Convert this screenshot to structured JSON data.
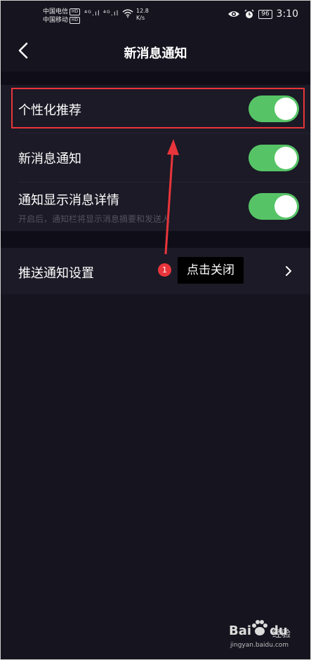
{
  "status_bar": {
    "carrier_1": "中国电信",
    "carrier_2": "中国移动",
    "hd_badge": "HD",
    "signal_1": "⁴ᴳ.ıl",
    "signal_2": "⁴ᴳ.ıl",
    "net_speed_value": "12.8",
    "net_speed_unit": "K/s",
    "battery": "96",
    "time": "3:10"
  },
  "header": {
    "title": "新消息通知"
  },
  "settings": {
    "personalized_recommendation": {
      "label": "个性化推荐",
      "enabled": true
    },
    "new_message_notification": {
      "label": "新消息通知",
      "enabled": true
    },
    "notification_details": {
      "label": "通知显示消息详情",
      "description": "开启后，通知栏将显示消息摘要和发送人",
      "enabled": true
    },
    "push_settings": {
      "label": "推送通知设置"
    }
  },
  "annotation": {
    "step_number": "1",
    "callout_text": "点击关闭",
    "color": "#e8353b"
  },
  "watermark": {
    "brand_left": "Bai",
    "brand_right": "du",
    "brand_cn": "经验",
    "url": "jingyan.baidu.com"
  },
  "colors": {
    "background": "#15141f",
    "panel": "#1b1a26",
    "toggle_on": "#56c466"
  }
}
